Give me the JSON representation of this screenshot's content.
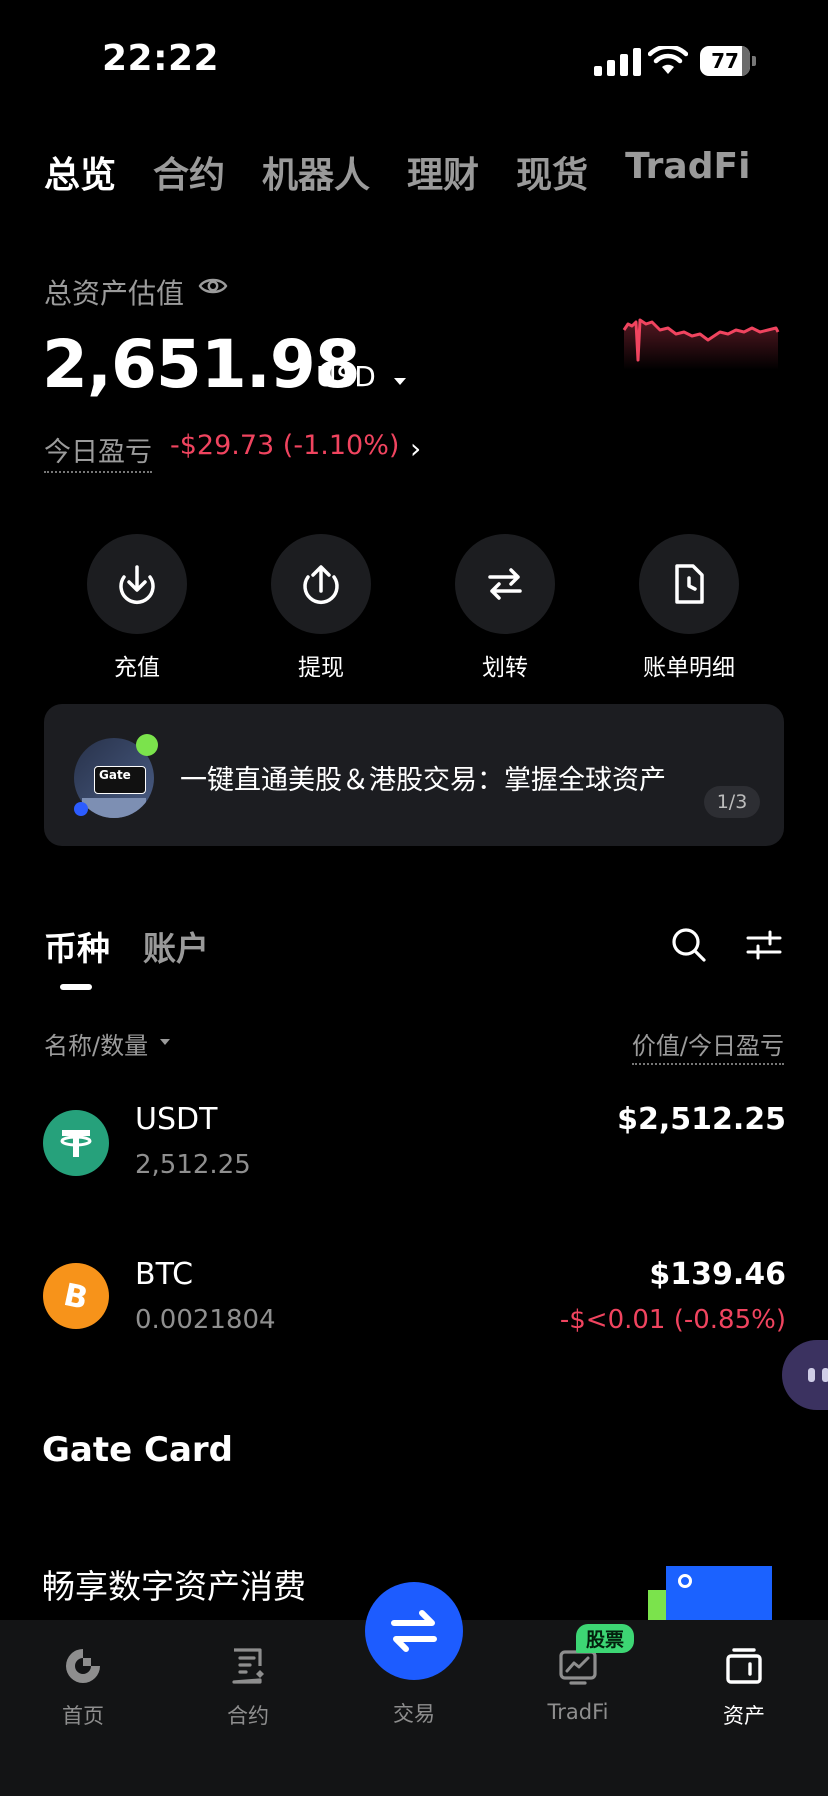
{
  "status_bar": {
    "time": "22:22",
    "battery": "77"
  },
  "top_tabs": [
    "总览",
    "合约",
    "机器人",
    "理财",
    "现货",
    "TradFi"
  ],
  "summary": {
    "label": "总资产估值",
    "amount": "2,651.98",
    "currency": "USD",
    "pnl_label": "今日盈亏",
    "pnl_value": "-$29.73 (-1.10%)"
  },
  "actions": [
    {
      "label": "充值",
      "icon": "deposit-icon"
    },
    {
      "label": "提现",
      "icon": "withdraw-icon"
    },
    {
      "label": "划转",
      "icon": "transfer-icon"
    },
    {
      "label": "账单明细",
      "icon": "bill-icon"
    }
  ],
  "banner": {
    "text": "一键直通美股＆港股交易：掌握全球资产",
    "thumb_text": "Gate",
    "page": "1/3"
  },
  "section": {
    "tabs": [
      "币种",
      "账户"
    ],
    "header_left": "名称/数量",
    "header_right": "价值/今日盈亏"
  },
  "coins": [
    {
      "symbol": "USDT",
      "quantity": "2,512.25",
      "value": "$2,512.25",
      "pnl": "",
      "color": "#26a17b"
    },
    {
      "symbol": "BTC",
      "quantity": "0.0021804",
      "value": "$139.46",
      "pnl": "-$<0.01 (-0.85%)",
      "color": "#f7931a"
    }
  ],
  "gate_card": {
    "title": "Gate Card",
    "subtitle": "畅享数字资产消费"
  },
  "bottom_nav": {
    "items": [
      "首页",
      "合约",
      "交易",
      "TradFi",
      "资产"
    ],
    "badge": "股票",
    "active": "资产"
  },
  "colors": {
    "accent": "#1d5cff",
    "negative": "#f0445f",
    "badge": "#3dd674"
  }
}
